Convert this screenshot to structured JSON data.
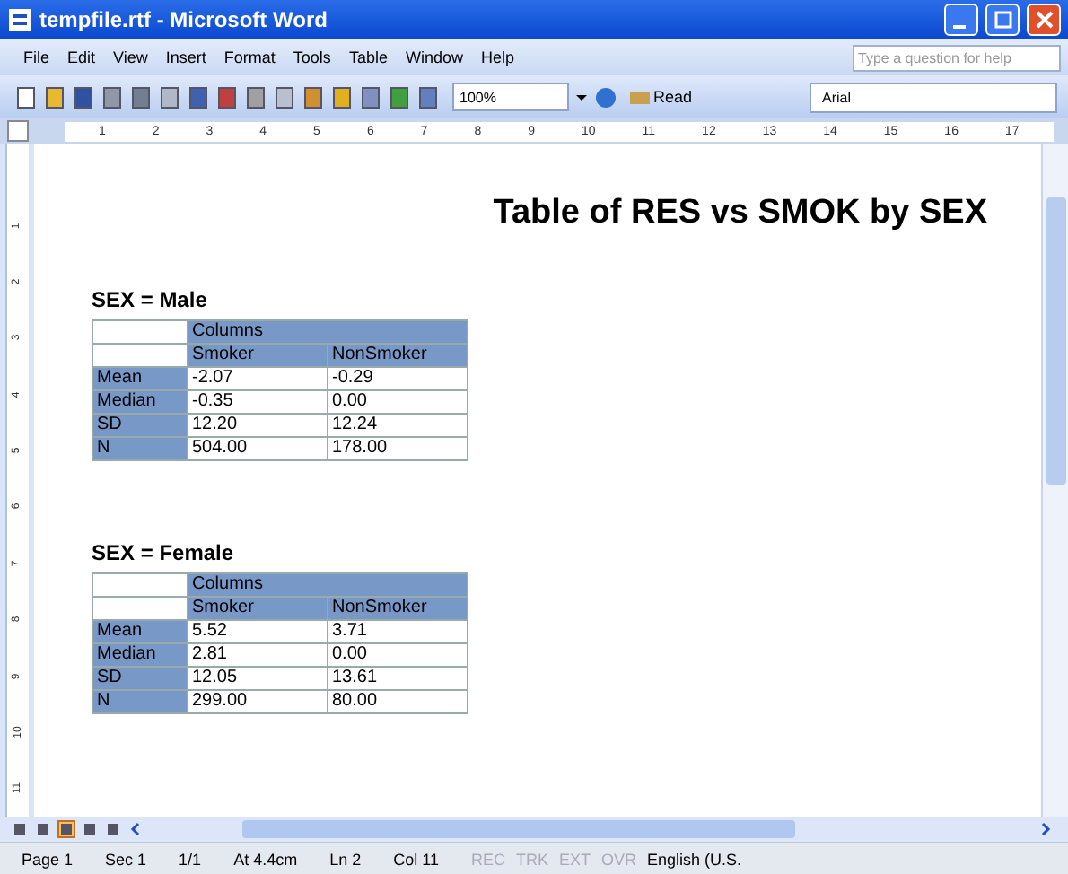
{
  "window": {
    "title": "tempfile.rtf - Microsoft Word"
  },
  "menu": [
    "File",
    "Edit",
    "View",
    "Insert",
    "Format",
    "Tools",
    "Table",
    "Window",
    "Help"
  ],
  "help_box": {
    "placeholder": "Type a question for help"
  },
  "toolbar": {
    "zoom": "100%",
    "read_button": "Read",
    "font": "Arial"
  },
  "ruler": {
    "horizontal": [
      "1",
      "2",
      "3",
      "4",
      "5",
      "6",
      "7",
      "8",
      "9",
      "10",
      "11",
      "12",
      "13",
      "14",
      "15",
      "16",
      "17"
    ],
    "vertical": [
      "1",
      "2",
      "3",
      "4",
      "5",
      "6",
      "7",
      "8",
      "9",
      "10",
      "11"
    ]
  },
  "document": {
    "heading": "Table of RES vs SMOK by SEX",
    "sections": [
      {
        "title": "SEX = Male",
        "group_header": "Columns",
        "columns": [
          "Smoker",
          "NonSmoker"
        ],
        "rows": [
          {
            "label": "Mean",
            "values": [
              "-2.07",
              "-0.29"
            ]
          },
          {
            "label": "Median",
            "values": [
              "-0.35",
              "0.00"
            ]
          },
          {
            "label": "SD",
            "values": [
              "12.20",
              "12.24"
            ]
          },
          {
            "label": "N",
            "values": [
              "504.00",
              "178.00"
            ]
          }
        ]
      },
      {
        "title": "SEX = Female",
        "group_header": "Columns",
        "columns": [
          "Smoker",
          "NonSmoker"
        ],
        "rows": [
          {
            "label": "Mean",
            "values": [
              "5.52",
              "3.71"
            ]
          },
          {
            "label": "Median",
            "values": [
              "2.81",
              "0.00"
            ]
          },
          {
            "label": "SD",
            "values": [
              "12.05",
              "13.61"
            ]
          },
          {
            "label": "N",
            "values": [
              "299.00",
              "80.00"
            ]
          }
        ]
      }
    ]
  },
  "view_buttons": [
    {
      "selected": false
    },
    {
      "selected": false
    },
    {
      "selected": true
    },
    {
      "selected": false
    },
    {
      "selected": false
    }
  ],
  "status_bar": [
    {
      "text": "Page 1",
      "disabled": false
    },
    {
      "text": "Sec 1",
      "disabled": false
    },
    {
      "text": "1/1",
      "disabled": false
    },
    {
      "text": "At 4.4cm",
      "disabled": false
    },
    {
      "text": "Ln 2",
      "disabled": false
    },
    {
      "text": "Col 11",
      "disabled": false
    },
    {
      "text": "REC",
      "disabled": true
    },
    {
      "text": "TRK",
      "disabled": true
    },
    {
      "text": "EXT",
      "disabled": true
    },
    {
      "text": "OVR",
      "disabled": true
    },
    {
      "text": "English (U.S.",
      "disabled": false
    }
  ]
}
